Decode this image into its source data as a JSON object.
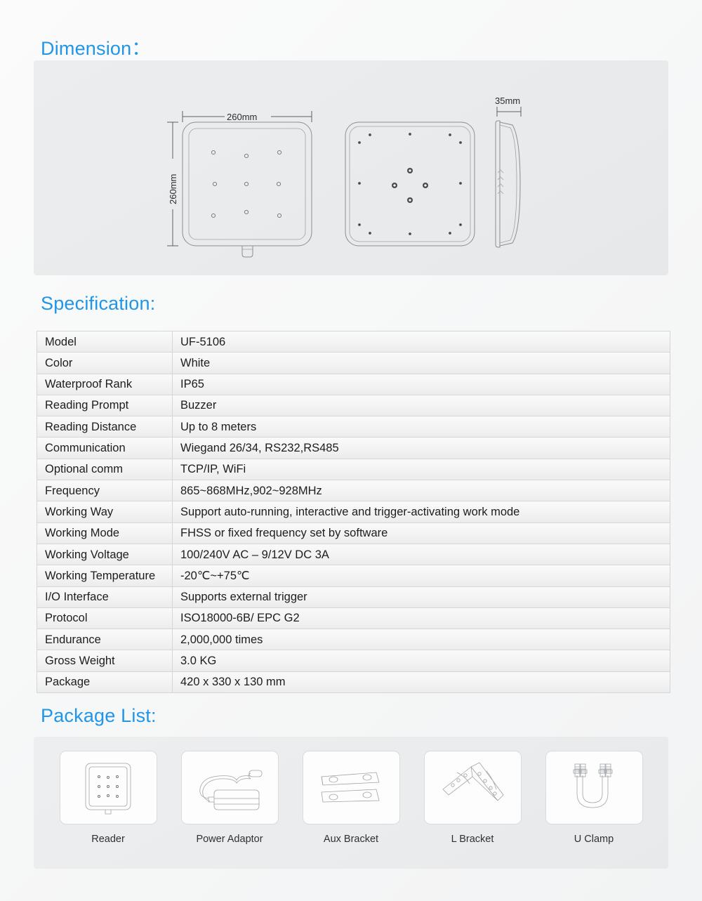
{
  "sections": {
    "dimension_title": "Dimension：",
    "specification_title": "Specification:",
    "package_title": "Package List:"
  },
  "theme": {
    "heading_color": "#2196e8",
    "panel_bg": "#eaecee",
    "page_bg": "#f7f8f8",
    "table_border": "#d4d6d8",
    "drawing_stroke": "#8c8f93"
  },
  "dimension": {
    "views": [
      {
        "name": "front-view",
        "label": "front"
      },
      {
        "name": "back-view",
        "label": "back"
      },
      {
        "name": "side-view",
        "label": "side"
      }
    ],
    "width_label": "260mm",
    "height_label": "260mm",
    "depth_label": "35mm",
    "front_dot_grid": {
      "rows": 3,
      "cols": 3
    }
  },
  "specification": {
    "rows": [
      {
        "key": "Model",
        "value": "UF-5106"
      },
      {
        "key": "Color",
        "value": "White"
      },
      {
        "key": "Waterproof Rank",
        "value": "IP65"
      },
      {
        "key": "Reading Prompt",
        "value": "Buzzer"
      },
      {
        "key": "Reading Distance",
        "value": "Up to 8 meters"
      },
      {
        "key": "Communication",
        "value": "Wiegand 26/34, RS232,RS485"
      },
      {
        "key": "Optional comm",
        "value": "TCP/IP, WiFi"
      },
      {
        "key": "Frequency",
        "value": "865~868MHz,902~928MHz"
      },
      {
        "key": "Working Way",
        "value": "Support auto-running, interactive and trigger-activating work mode"
      },
      {
        "key": "Working Mode",
        "value": "FHSS or fixed frequency set by software"
      },
      {
        "key": "Working Voltage",
        "value": "100/240V AC – 9/12V DC 3A"
      },
      {
        "key": "Working Temperature",
        "value": "-20℃~+75℃"
      },
      {
        "key": "I/O Interface",
        "value": "Supports external trigger"
      },
      {
        "key": "Protocol",
        "value": "ISO18000-6B/ EPC G2"
      },
      {
        "key": "Endurance",
        "value": "2,000,000 times"
      },
      {
        "key": "Gross Weight",
        "value": "3.0 KG"
      },
      {
        "key": "Package",
        "value": "420 x 330 x 130 mm"
      }
    ]
  },
  "package_list": {
    "items": [
      {
        "label": "Reader",
        "icon": "reader-icon"
      },
      {
        "label": "Power Adaptor",
        "icon": "power-adaptor-icon"
      },
      {
        "label": "Aux Bracket",
        "icon": "aux-bracket-icon"
      },
      {
        "label": "L Bracket",
        "icon": "l-bracket-icon"
      },
      {
        "label": "U Clamp",
        "icon": "u-clamp-icon"
      }
    ]
  }
}
